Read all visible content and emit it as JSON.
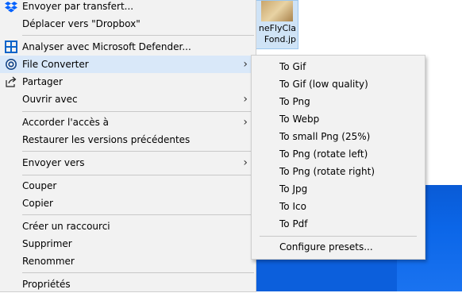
{
  "file": {
    "label_line1": "neFlyCla",
    "label_line2": "Fond.jp"
  },
  "main_menu": {
    "send_transfer": "Envoyer par transfert...",
    "move_dropbox": "Déplacer vers \"Dropbox\"",
    "defender": "Analyser avec Microsoft Defender...",
    "file_converter": "File Converter",
    "share": "Partager",
    "open_with": "Ouvrir avec",
    "grant_access": "Accorder l'accès à",
    "restore_versions": "Restaurer les versions précédentes",
    "send_to": "Envoyer vers",
    "cut": "Couper",
    "copy": "Copier",
    "create_shortcut": "Créer un raccourci",
    "delete": "Supprimer",
    "rename": "Renommer",
    "properties": "Propriétés"
  },
  "submenu": {
    "items": [
      "To Gif",
      "To Gif (low quality)",
      "To Png",
      "To Webp",
      "To small Png (25%)",
      "To Png (rotate left)",
      "To Png (rotate right)",
      "To Jpg",
      "To Ico",
      "To Pdf"
    ],
    "configure": "Configure presets..."
  },
  "colors": {
    "highlight": "#d9e8f9",
    "menu_bg": "#f2f2f2",
    "desktop_blue": "#0c5fdc"
  },
  "icons": {
    "send_transfer": "dropbox-icon",
    "defender": "defender-shield-icon",
    "file_converter": "file-converter-icon",
    "share": "share-icon",
    "submenu_arrow": "chevron-right-icon"
  }
}
